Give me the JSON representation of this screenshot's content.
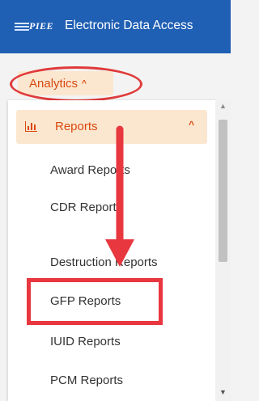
{
  "header": {
    "logo_text": "PIEE",
    "app_title": "Electronic Data Access"
  },
  "nav": {
    "analytics_label": "Analytics"
  },
  "menu": {
    "reports_label": "Reports",
    "items": [
      "Award Reports",
      "CDR Reports",
      "Destruction Reports",
      "GFP Reports",
      "IUID Reports",
      "PCM Reports"
    ]
  },
  "annotations": {
    "highlight_color": "#e8373f"
  }
}
